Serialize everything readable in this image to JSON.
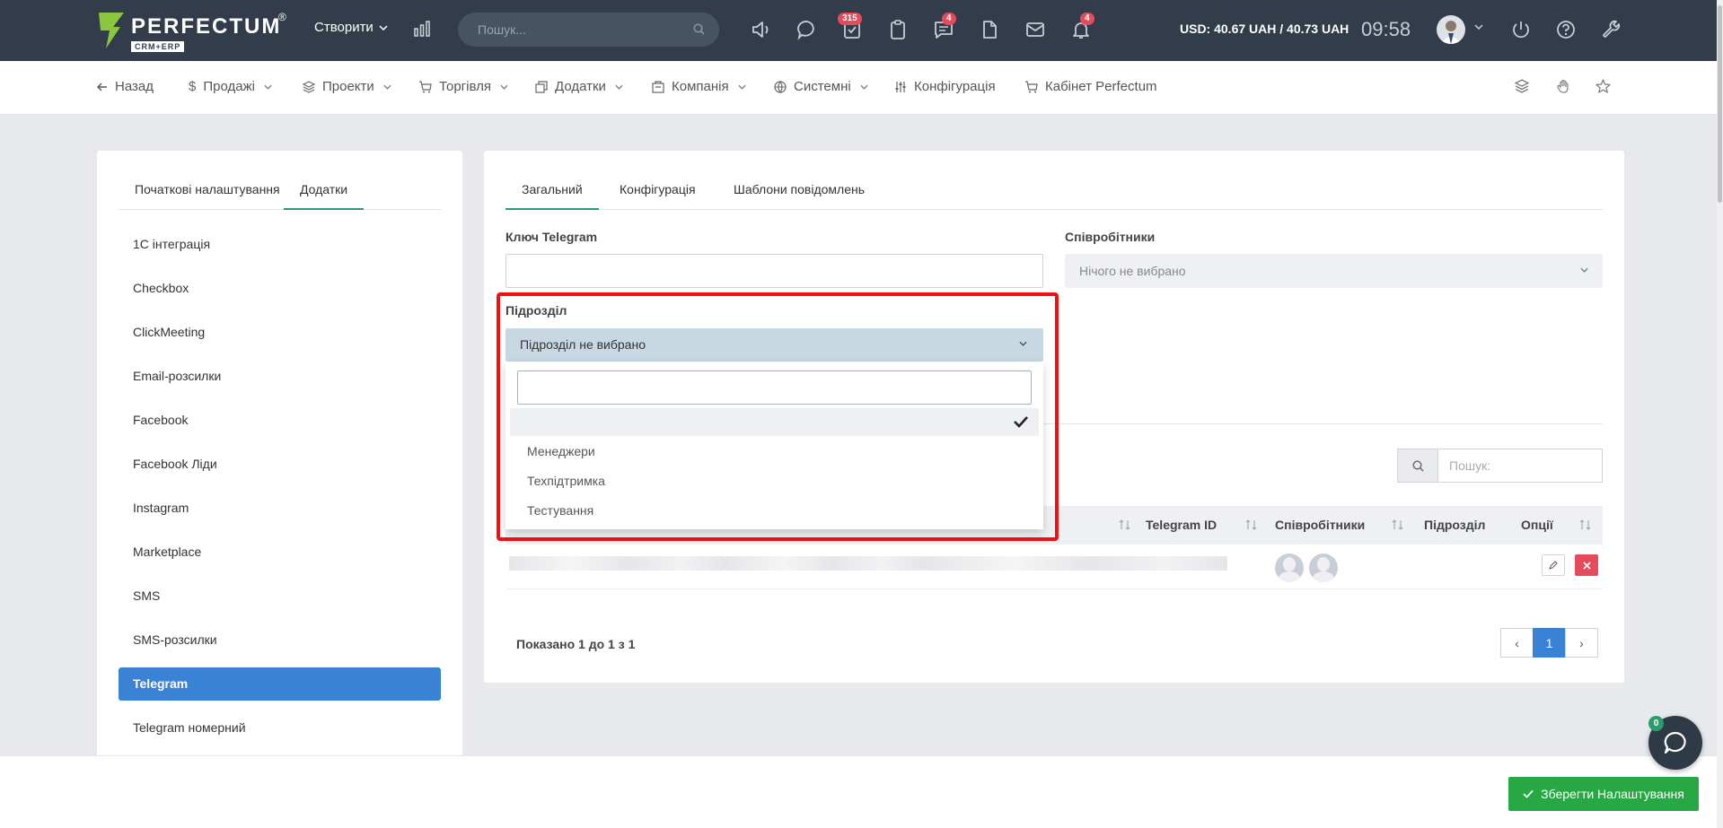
{
  "topbar": {
    "logo_text": "PERFECTUM",
    "logo_sub": "CRM+ERP",
    "logo_reg": "®",
    "create_label": "Створити",
    "search_placeholder": "Пошук...",
    "tasks_badge": "315",
    "comments_badge": "4",
    "notifications_badge": "4",
    "currency": "USD: 40.67 UAH / 40.73 UAH",
    "clock": "09:58"
  },
  "nav": {
    "back": "Назад",
    "items": [
      "Продажі",
      "Проекти",
      "Торгівля",
      "Додатки",
      "Компанія",
      "Системні",
      "Конфігурація",
      "Кабінет Perfectum"
    ]
  },
  "left": {
    "tabs": [
      "Початкові налаштування",
      "Додатки"
    ],
    "active_tab": 1,
    "menu": [
      "1C інтеграція",
      "Checkbox",
      "ClickMeeting",
      "Email-розсилки",
      "Facebook",
      "Facebook Ліди",
      "Instagram",
      "Marketplace",
      "SMS",
      "SMS-розсилки",
      "Telegram",
      "Telegram номерний"
    ],
    "active_item": "Telegram"
  },
  "main": {
    "tabs": [
      "Загальний",
      "Конфігурація",
      "Шаблони повідомлень"
    ],
    "active_tab": 0,
    "telegram_key_label": "Ключ Telegram",
    "telegram_key_value": "",
    "employees_label": "Співробітники",
    "employees_value": "Нічого не вибрано",
    "department_label": "Підрозділ",
    "department_value": "Підрозділ не вибрано",
    "search_placeholder": "Пошук:",
    "table_headers": [
      "Telegram ID",
      "Співробітники",
      "Підрозділ",
      "Опції"
    ],
    "showing": "Показано 1 до 1 з 1",
    "pagination": {
      "prev": "‹",
      "current": "1",
      "next": "›"
    }
  },
  "dropdown": {
    "search_value": "",
    "options": [
      "",
      "Менеджери",
      "Техпідтримка",
      "Тестування"
    ],
    "selected_index": 0
  },
  "footer": {
    "save_label": "Зберегти Налаштування",
    "chat_badge": "0"
  },
  "colors": {
    "topbar": "#323c4a",
    "accent_green": "#2c9c6c",
    "active_blue": "#3a82d4",
    "danger_red": "#e44c5c",
    "save_green": "#28a745",
    "highlight_outline": "#e11111"
  }
}
